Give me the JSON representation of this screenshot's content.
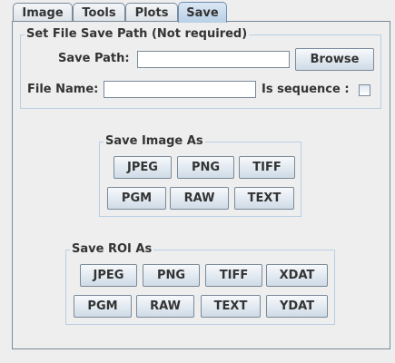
{
  "tabs": [
    {
      "label": "Image"
    },
    {
      "label": "Tools"
    },
    {
      "label": "Plots"
    },
    {
      "label": "Save",
      "active": true
    }
  ],
  "file_path_group": {
    "title": "Set File Save Path (Not required)",
    "save_path_label": "Save Path:",
    "save_path_value": "",
    "browse_label": "Browse",
    "file_name_label": "File Name:",
    "file_name_value": "",
    "is_sequence_label": "Is sequence :",
    "is_sequence_checked": false
  },
  "save_image_group": {
    "title": "Save Image As",
    "buttons": [
      "JPEG",
      "PNG",
      "TIFF",
      "PGM",
      "RAW",
      "TEXT"
    ]
  },
  "save_roi_group": {
    "title": "Save ROI As",
    "buttons": [
      "JPEG",
      "PNG",
      "TIFF",
      "XDAT",
      "PGM",
      "RAW",
      "TEXT",
      "YDAT"
    ]
  }
}
